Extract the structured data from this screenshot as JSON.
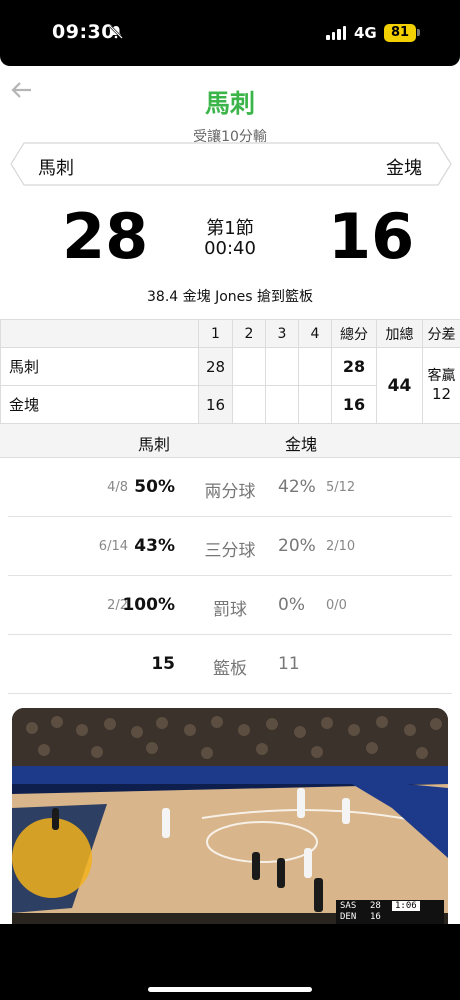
{
  "status_bar": {
    "time": "09:30",
    "network": "4G",
    "battery": "81",
    "icons": [
      "bell-slash-icon",
      "signal-icon"
    ],
    "battery_color": "#f2d000"
  },
  "header": {
    "title": "馬刺",
    "handicap": "受讓10分輸",
    "title_color": "#3bb54a",
    "back_icon": "arrow-left-icon"
  },
  "teams": {
    "home": "馬刺",
    "away": "金塊"
  },
  "scoreboard": {
    "home_score": "28",
    "away_score": "16",
    "period": "第1節",
    "clock": "00:40",
    "last_play": "38.4 金塊 Jones 搶到籃板"
  },
  "quarter_table": {
    "headers": [
      "",
      "1",
      "2",
      "3",
      "4",
      "總分",
      "加總",
      "分差"
    ],
    "rows": [
      {
        "team": "馬刺",
        "q": [
          "28",
          "",
          "",
          ""
        ],
        "total": "28"
      },
      {
        "team": "金塊",
        "q": [
          "16",
          "",
          "",
          ""
        ],
        "total": "16"
      }
    ],
    "sum_total": "44",
    "margin_label": "客贏",
    "margin_value": "12"
  },
  "team_stats": {
    "home_label": "馬刺",
    "away_label": "金塊",
    "rows": [
      {
        "name": "兩分球",
        "home_frac": "4/8",
        "home_pct": "50%",
        "away_pct": "42%",
        "away_frac": "5/12"
      },
      {
        "name": "三分球",
        "home_frac": "6/14",
        "home_pct": "43%",
        "away_pct": "20%",
        "away_frac": "2/10"
      },
      {
        "name": "罰球",
        "home_frac": "2/2",
        "home_pct": "100%",
        "away_pct": "0%",
        "away_frac": "0/0"
      },
      {
        "name": "籃板",
        "home_frac": "",
        "home_pct": "15",
        "away_pct": "11",
        "away_frac": ""
      }
    ]
  },
  "video": {
    "scorebug": {
      "team1": "SAS",
      "score1": "28",
      "team2": "DEN",
      "score2": "16",
      "clock": "1:06"
    }
  }
}
